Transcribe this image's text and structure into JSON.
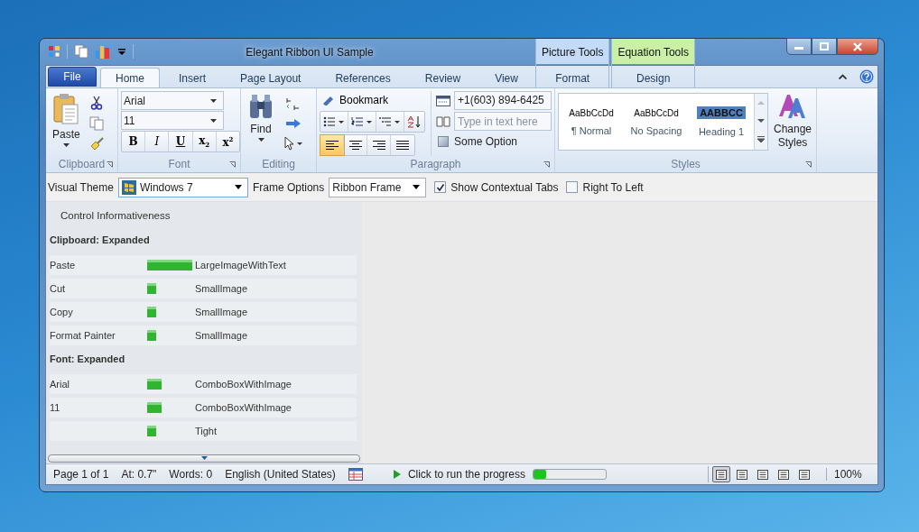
{
  "window": {
    "title": "Elegant Ribbon UI Sample"
  },
  "tabs": [
    {
      "label": "File",
      "kind": "file",
      "selected": false
    },
    {
      "label": "Home",
      "kind": "tab",
      "selected": true
    },
    {
      "label": "Insert",
      "kind": "tab",
      "selected": false
    },
    {
      "label": "Page Layout",
      "kind": "tab",
      "selected": false
    },
    {
      "label": "References",
      "kind": "tab",
      "selected": false
    },
    {
      "label": "Review",
      "kind": "tab",
      "selected": false
    },
    {
      "label": "View",
      "kind": "tab",
      "selected": false
    }
  ],
  "contextual_groups": [
    {
      "label": "Picture Tools",
      "color": "#c4dbf7",
      "tabs": [
        {
          "label": "Format",
          "selected": false
        }
      ]
    },
    {
      "label": "Equation Tools",
      "color": "#c9f0a4",
      "tabs": [
        {
          "label": "Design",
          "selected": false
        }
      ]
    }
  ],
  "ribbon": {
    "clipboard": {
      "label": "Clipboard",
      "paste": "Paste"
    },
    "font": {
      "label": "Font",
      "family": "Arial",
      "size": "11",
      "format_buttons": [
        "B",
        "I",
        "U",
        "x$_{2}$",
        "x$^{2}$"
      ]
    },
    "editing": {
      "label": "Editing",
      "find": "Find"
    },
    "paragraph": {
      "label": "Paragraph",
      "bookmark": "Bookmark",
      "alignments": [
        {
          "selected": true
        },
        {
          "selected": false
        },
        {
          "selected": false
        },
        {
          "selected": false
        }
      ],
      "phone": "+1(603) 894-6425",
      "text_placeholder": "Type in text here",
      "option": {
        "label": "Some Option",
        "checked": false
      }
    },
    "styles": {
      "label": "Styles",
      "gallery": [
        {
          "sample": "AaBbCcDd",
          "name": "¶ Normal",
          "kind": "normal"
        },
        {
          "sample": "AaBbCcDd",
          "name": "No Spacing",
          "kind": "normal"
        },
        {
          "sample": "AABBCC",
          "name": "Heading 1",
          "kind": "heading"
        }
      ],
      "change_styles": "Change Styles"
    }
  },
  "options": {
    "visual_theme_label": "Visual Theme",
    "visual_theme": "Windows 7",
    "frame_label": "Frame Options",
    "frame": "Ribbon Frame",
    "checks": [
      {
        "label": "Show Contextual Tabs",
        "checked": true
      },
      {
        "label": "Right To Left",
        "checked": false
      }
    ]
  },
  "informativeness": {
    "title": "Control Informativeness",
    "sections": [
      {
        "title": "Clipboard: Expanded",
        "rows": [
          {
            "name": "Paste",
            "kind": "large",
            "mode": "LargeImageWithText"
          },
          {
            "name": "Cut",
            "kind": "small",
            "mode": "SmallImage"
          },
          {
            "name": "Copy",
            "kind": "small",
            "mode": "SmallImage"
          },
          {
            "name": "Format Painter",
            "kind": "small",
            "mode": "SmallImage"
          }
        ]
      },
      {
        "title": "Font: Expanded",
        "rows": [
          {
            "name": "Arial",
            "kind": "combo",
            "mode": "ComboBoxWithImage"
          },
          {
            "name": "11",
            "kind": "combo",
            "mode": "ComboBoxWithImage"
          },
          {
            "kind": "small",
            "mode": "Tight"
          }
        ]
      }
    ]
  },
  "status_bar": {
    "items": [
      "Page 1 of 1",
      "At: 0.7\"",
      "Words: 0",
      "English (United States)"
    ],
    "progress_label": "Click to run the progress",
    "progress": {
      "level": 0.18
    },
    "views": [
      {
        "selected": true
      },
      {
        "selected": false
      },
      {
        "selected": false
      },
      {
        "selected": false
      },
      {
        "selected": false
      }
    ],
    "zoom": "100%"
  }
}
